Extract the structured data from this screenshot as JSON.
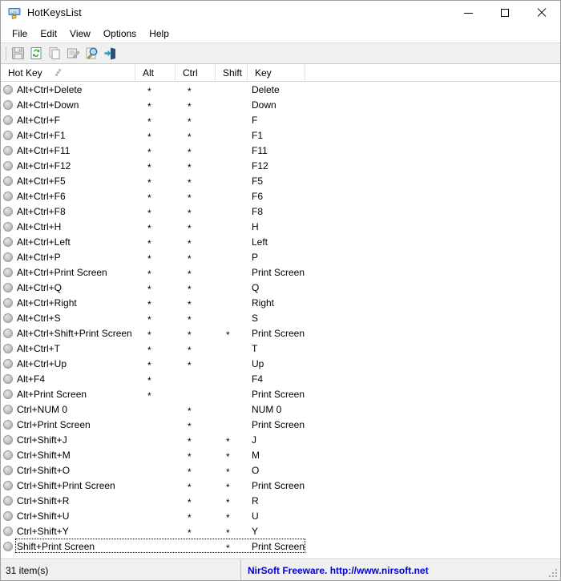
{
  "window": {
    "title": "HotKeysList",
    "icon": "keyboard-hand-icon",
    "controls": {
      "minimize": "Minimize",
      "maximize": "Maximize",
      "close": "Close"
    }
  },
  "menubar": {
    "items": [
      {
        "label": "File"
      },
      {
        "label": "Edit"
      },
      {
        "label": "View"
      },
      {
        "label": "Options"
      },
      {
        "label": "Help"
      }
    ]
  },
  "toolbar": {
    "buttons": [
      {
        "name": "save-icon",
        "title": "Save Selected Items",
        "enabled": false
      },
      {
        "name": "refresh-icon",
        "title": "Refresh",
        "enabled": true
      },
      {
        "name": "copy-icon",
        "title": "Copy Selected Items",
        "enabled": false
      },
      {
        "name": "properties-icon",
        "title": "Properties",
        "enabled": false
      },
      {
        "name": "find-icon",
        "title": "Find",
        "enabled": true
      },
      {
        "name": "exit-icon",
        "title": "Exit",
        "enabled": true
      }
    ]
  },
  "list": {
    "columns": [
      {
        "key": "hotkey",
        "label": "Hot Key",
        "sorted": "asc"
      },
      {
        "key": "alt",
        "label": "Alt"
      },
      {
        "key": "ctrl",
        "label": "Ctrl"
      },
      {
        "key": "shift",
        "label": "Shift"
      },
      {
        "key": "key",
        "label": "Key"
      }
    ],
    "star": "*",
    "rows": [
      {
        "hotkey": "Alt+Ctrl+Delete",
        "alt": "*",
        "ctrl": "*",
        "shift": "",
        "key": "Delete"
      },
      {
        "hotkey": "Alt+Ctrl+Down",
        "alt": "*",
        "ctrl": "*",
        "shift": "",
        "key": "Down"
      },
      {
        "hotkey": "Alt+Ctrl+F",
        "alt": "*",
        "ctrl": "*",
        "shift": "",
        "key": "F"
      },
      {
        "hotkey": "Alt+Ctrl+F1",
        "alt": "*",
        "ctrl": "*",
        "shift": "",
        "key": "F1"
      },
      {
        "hotkey": "Alt+Ctrl+F11",
        "alt": "*",
        "ctrl": "*",
        "shift": "",
        "key": "F11"
      },
      {
        "hotkey": "Alt+Ctrl+F12",
        "alt": "*",
        "ctrl": "*",
        "shift": "",
        "key": "F12"
      },
      {
        "hotkey": "Alt+Ctrl+F5",
        "alt": "*",
        "ctrl": "*",
        "shift": "",
        "key": "F5"
      },
      {
        "hotkey": "Alt+Ctrl+F6",
        "alt": "*",
        "ctrl": "*",
        "shift": "",
        "key": "F6"
      },
      {
        "hotkey": "Alt+Ctrl+F8",
        "alt": "*",
        "ctrl": "*",
        "shift": "",
        "key": "F8"
      },
      {
        "hotkey": "Alt+Ctrl+H",
        "alt": "*",
        "ctrl": "*",
        "shift": "",
        "key": "H"
      },
      {
        "hotkey": "Alt+Ctrl+Left",
        "alt": "*",
        "ctrl": "*",
        "shift": "",
        "key": "Left"
      },
      {
        "hotkey": "Alt+Ctrl+P",
        "alt": "*",
        "ctrl": "*",
        "shift": "",
        "key": "P"
      },
      {
        "hotkey": "Alt+Ctrl+Print Screen",
        "alt": "*",
        "ctrl": "*",
        "shift": "",
        "key": "Print Screen"
      },
      {
        "hotkey": "Alt+Ctrl+Q",
        "alt": "*",
        "ctrl": "*",
        "shift": "",
        "key": "Q"
      },
      {
        "hotkey": "Alt+Ctrl+Right",
        "alt": "*",
        "ctrl": "*",
        "shift": "",
        "key": "Right"
      },
      {
        "hotkey": "Alt+Ctrl+S",
        "alt": "*",
        "ctrl": "*",
        "shift": "",
        "key": "S"
      },
      {
        "hotkey": "Alt+Ctrl+Shift+Print Screen",
        "alt": "*",
        "ctrl": "*",
        "shift": "*",
        "key": "Print Screen"
      },
      {
        "hotkey": "Alt+Ctrl+T",
        "alt": "*",
        "ctrl": "*",
        "shift": "",
        "key": "T"
      },
      {
        "hotkey": "Alt+Ctrl+Up",
        "alt": "*",
        "ctrl": "*",
        "shift": "",
        "key": "Up"
      },
      {
        "hotkey": "Alt+F4",
        "alt": "*",
        "ctrl": "",
        "shift": "",
        "key": "F4"
      },
      {
        "hotkey": "Alt+Print Screen",
        "alt": "*",
        "ctrl": "",
        "shift": "",
        "key": "Print Screen"
      },
      {
        "hotkey": "Ctrl+NUM 0",
        "alt": "",
        "ctrl": "*",
        "shift": "",
        "key": "NUM 0"
      },
      {
        "hotkey": "Ctrl+Print Screen",
        "alt": "",
        "ctrl": "*",
        "shift": "",
        "key": "Print Screen"
      },
      {
        "hotkey": "Ctrl+Shift+J",
        "alt": "",
        "ctrl": "*",
        "shift": "*",
        "key": "J"
      },
      {
        "hotkey": "Ctrl+Shift+M",
        "alt": "",
        "ctrl": "*",
        "shift": "*",
        "key": "M"
      },
      {
        "hotkey": "Ctrl+Shift+O",
        "alt": "",
        "ctrl": "*",
        "shift": "*",
        "key": "O"
      },
      {
        "hotkey": "Ctrl+Shift+Print Screen",
        "alt": "",
        "ctrl": "*",
        "shift": "*",
        "key": "Print Screen"
      },
      {
        "hotkey": "Ctrl+Shift+R",
        "alt": "",
        "ctrl": "*",
        "shift": "*",
        "key": "R"
      },
      {
        "hotkey": "Ctrl+Shift+U",
        "alt": "",
        "ctrl": "*",
        "shift": "*",
        "key": "U"
      },
      {
        "hotkey": "Ctrl+Shift+Y",
        "alt": "",
        "ctrl": "*",
        "shift": "*",
        "key": "Y"
      },
      {
        "hotkey": "Shift+Print Screen",
        "alt": "",
        "ctrl": "",
        "shift": "*",
        "key": "Print Screen",
        "focused": true
      }
    ]
  },
  "statusbar": {
    "count": "31 item(s)",
    "credit": "NirSoft Freeware.  http://www.nirsoft.net",
    "credit_color": "#0000d0"
  }
}
